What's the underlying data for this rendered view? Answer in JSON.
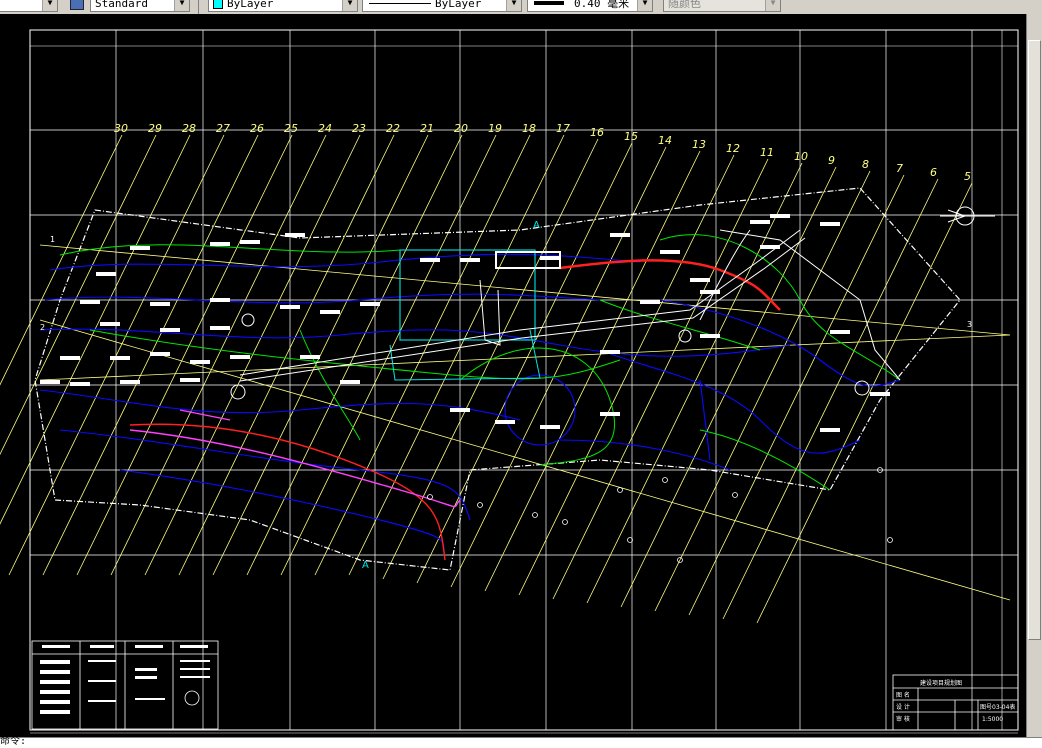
{
  "toolbar": {
    "text_style": "Standard",
    "layer": "ByLayer",
    "linetype": "ByLayer",
    "lineweight": "0.40 毫米",
    "plot_style": "随颜色",
    "layer_color_hex": "#00ffff"
  },
  "drawing": {
    "background_color": "#000000",
    "contour_color_primary": "#0000ff",
    "contour_color_secondary": "#00ff00",
    "grid_line_color": "#ffff80",
    "border_color": "#ffffff",
    "section_lines": [
      "30",
      "29",
      "28",
      "27",
      "26",
      "25",
      "24",
      "23",
      "22",
      "21",
      "20",
      "19",
      "18",
      "17",
      "16",
      "15",
      "14",
      "13",
      "12",
      "11",
      "10",
      "9",
      "8",
      "7",
      "6",
      "5"
    ],
    "row_markers": [
      "1",
      "2",
      "3"
    ],
    "section_marks": [
      "A",
      "A"
    ]
  },
  "title_block": {
    "project": "建设项目规划图",
    "row_labels": [
      "图 名",
      "设 计",
      "审 核"
    ],
    "drawing_no": "图号03-04表",
    "scale": "1:5000"
  },
  "command_line": {
    "prompt": "命令:"
  }
}
